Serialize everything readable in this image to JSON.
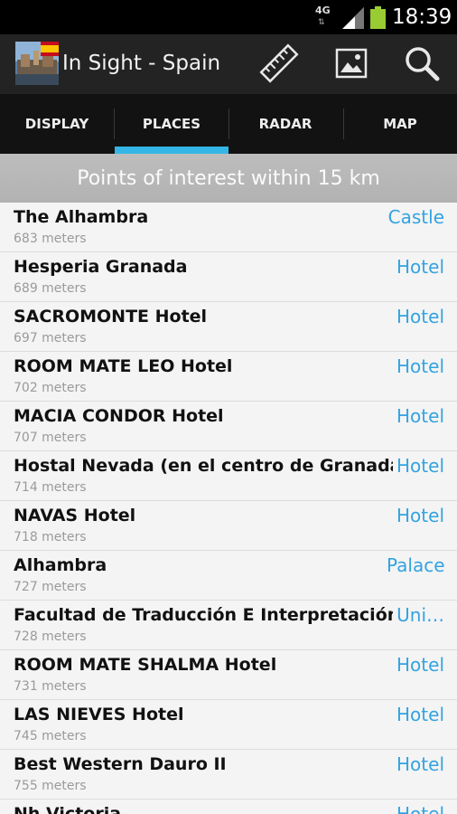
{
  "status_bar": {
    "network": "4G",
    "network_arrows": "⇅",
    "time": "18:39",
    "signal_icon": "signal-bars",
    "battery_icon": "battery"
  },
  "action_bar": {
    "title": "In Sight - Spain",
    "logo_icon": "app-logo-flag",
    "actions": [
      "ruler-icon",
      "image-icon",
      "search-icon"
    ]
  },
  "tabs": [
    {
      "label": "DISPLAY",
      "selected": false
    },
    {
      "label": "PLACES",
      "selected": true
    },
    {
      "label": "RADAR",
      "selected": false
    },
    {
      "label": "MAP",
      "selected": false
    }
  ],
  "section_header": "Points of interest within 15 km",
  "places": [
    {
      "name": "The Alhambra",
      "distance": "683 meters",
      "type": "Castle"
    },
    {
      "name": "Hesperia Granada",
      "distance": "689 meters",
      "type": "Hotel"
    },
    {
      "name": "SACROMONTE Hotel",
      "distance": "697 meters",
      "type": "Hotel"
    },
    {
      "name": "ROOM MATE LEO Hotel",
      "distance": "702 meters",
      "type": "Hotel"
    },
    {
      "name": "MACIA CONDOR Hotel",
      "distance": "707 meters",
      "type": "Hotel"
    },
    {
      "name": "Hostal Nevada (en el centro de Granada)",
      "distance": "714 meters",
      "type": "Hotel"
    },
    {
      "name": "NAVAS Hotel",
      "distance": "718 meters",
      "type": "Hotel"
    },
    {
      "name": "Alhambra",
      "distance": "727 meters",
      "type": "Palace"
    },
    {
      "name": "Facultad de Traducción E Interpretación",
      "distance": "728 meters",
      "type": "Uni…"
    },
    {
      "name": "ROOM MATE SHALMA Hotel",
      "distance": "731 meters",
      "type": "Hotel"
    },
    {
      "name": "LAS NIEVES Hotel",
      "distance": "745 meters",
      "type": "Hotel"
    },
    {
      "name": "Best Western Dauro II",
      "distance": "755 meters",
      "type": "Hotel"
    },
    {
      "name": "Nh Victoria",
      "distance": "",
      "type": "Hotel"
    }
  ],
  "colors": {
    "accent": "#33b5e5",
    "type_text": "#33a3e0",
    "action_bar": "#232323",
    "tab_bar": "#121212",
    "header_bg": "#b5b5b5"
  }
}
